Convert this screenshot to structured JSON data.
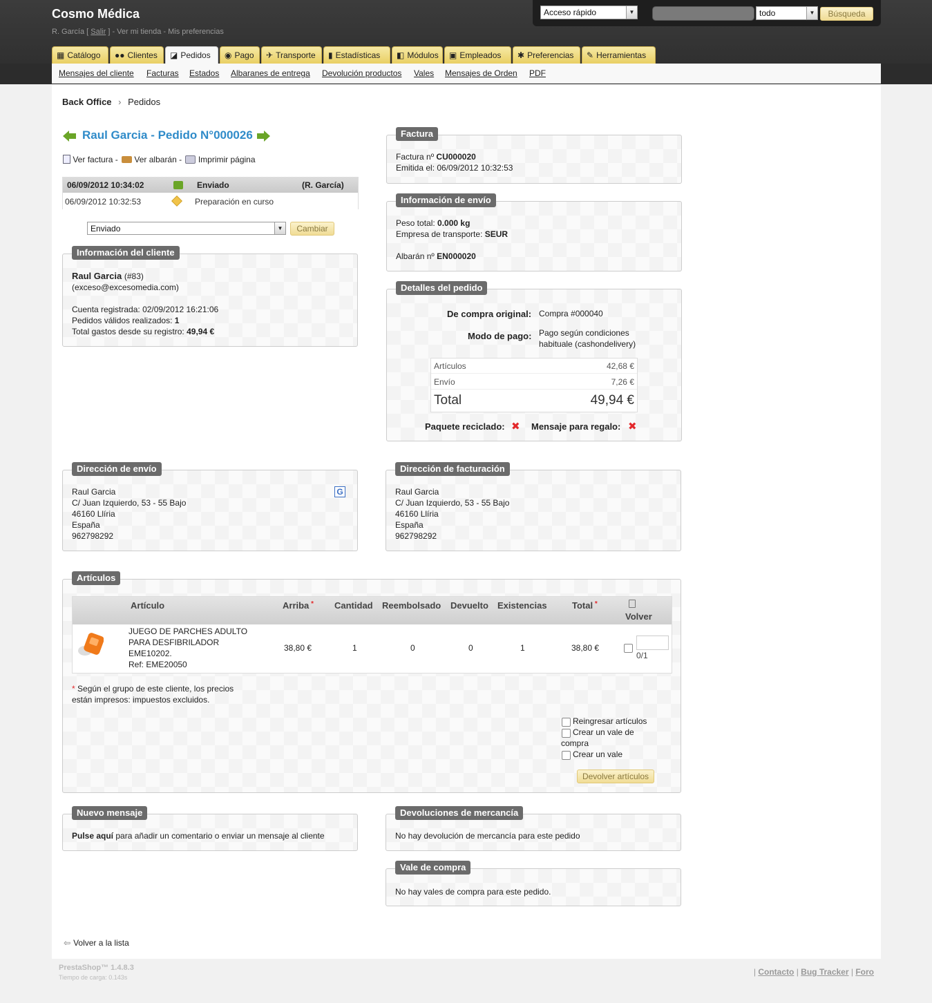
{
  "header": {
    "shop_name": "Cosmo Médica",
    "user_name": "R. García [",
    "logout": "Salir",
    "user_rest": "] - Ver mi tienda - Mis preferencias",
    "quick_access": "Acceso rápido",
    "search_scope": "todo",
    "search_button": "Búsqueda"
  },
  "tabs": [
    {
      "label": "Catálogo",
      "icon": "catalog-icon"
    },
    {
      "label": "Clientes",
      "icon": "customers-icon"
    },
    {
      "label": "Pedidos",
      "icon": "orders-icon"
    },
    {
      "label": "Pago",
      "icon": "payment-icon"
    },
    {
      "label": "Transporte",
      "icon": "shipping-icon"
    },
    {
      "label": "Estadísticas",
      "icon": "stats-icon"
    },
    {
      "label": "Módulos",
      "icon": "modules-icon"
    },
    {
      "label": "Empleados",
      "icon": "employees-icon"
    },
    {
      "label": "Preferencias",
      "icon": "preferences-icon"
    },
    {
      "label": "Herramientas",
      "icon": "tools-icon"
    }
  ],
  "subnav": [
    "Mensajes del cliente",
    "Facturas",
    "Estados",
    "Albaranes de entrega",
    "Devolución productos",
    "Vales",
    "Mensajes de Orden",
    "PDF"
  ],
  "breadcrumb": {
    "root": "Back Office",
    "current": "Pedidos"
  },
  "order": {
    "title": "Raul Garcia - Pedido N°000026",
    "view_invoice": "Ver factura -",
    "view_delivery": "Ver albarán -",
    "print_page": "Imprimir página",
    "history": [
      {
        "date": "06/09/2012 10:34:02",
        "state": "Enviado",
        "employee": "(R. García)"
      },
      {
        "date": "06/09/2012 10:32:53",
        "state": "Preparación en curso",
        "employee": ""
      }
    ],
    "state_select": "Enviado",
    "change_button": "Cambiar"
  },
  "customer": {
    "legend": "Información del cliente",
    "name": "Raul Garcia",
    "id": "(#83)",
    "email": "(exceso@excesomedia.com)",
    "registered_label": "Cuenta registrada:",
    "registered": "02/09/2012 16:21:06",
    "valid_orders_label": "Pedidos válidos realizados:",
    "valid_orders": "1",
    "total_spent_label": "Total gastos desde su registro:",
    "total_spent": "49,94 €"
  },
  "invoice": {
    "legend": "Factura",
    "number_label": "Factura nº",
    "number": "CU000020",
    "issued_label": "Emitida el:",
    "issued": "06/09/2012 10:32:53"
  },
  "shipping_info": {
    "legend": "Información de envío",
    "weight_label": "Peso total:",
    "weight": "0.000 kg",
    "carrier_label": "Empresa de transporte:",
    "carrier": "SEUR",
    "delivery_label": "Albarán nº",
    "delivery": "EN000020"
  },
  "order_details": {
    "legend": "Detalles del pedido",
    "original_label": "De compra original:",
    "original": "Compra #000040",
    "payment_label": "Modo de pago:",
    "payment_line1": "Pago según condiciones",
    "payment_line2": "habituale (cashondelivery)",
    "articles_label": "Artículos",
    "articles": "42,68 €",
    "shipping_label": "Envío",
    "shipping": "7,26 €",
    "total_label": "Total",
    "total": "49,94 €",
    "recycled_label": "Paquete reciclado:",
    "gift_label": "Mensaje para regalo:"
  },
  "shipping_address": {
    "legend": "Dirección de envío",
    "lines": [
      "Raul Garcia",
      "C/ Juan Izquierdo, 53 - 55 Bajo",
      "46160 Llíria",
      "España",
      "962798292"
    ]
  },
  "billing_address": {
    "legend": "Dirección de facturación",
    "lines": [
      "Raul Garcia",
      "C/ Juan Izquierdo, 53 - 55 Bajo",
      "46160 Llíria",
      "España",
      "962798292"
    ]
  },
  "products": {
    "legend": "Artículos",
    "columns": [
      "Artículo",
      "Arriba",
      "Cantidad",
      "Reembolsado",
      "Devuelto",
      "Existencias",
      "Total",
      "Volver"
    ],
    "rows": [
      {
        "name_lines": [
          "JUEGO DE PARCHES ADULTO",
          "PARA DESFIBRILADOR",
          "EME10202.",
          "Ref: EME20050"
        ],
        "price": "38,80 €",
        "quantity": "1",
        "refunded": "0",
        "returned": "0",
        "stock": "1",
        "total": "38,80 €",
        "return_qty": "0/1"
      }
    ],
    "note_line1": "Según el grupo de este cliente, los precios",
    "note_line2": "están impresos: impuestos excluidos.",
    "reinject": "Reingresar artículos",
    "voucher_line1": "Crear un vale de",
    "voucher_line2": "compra",
    "voucher": "Crear un vale",
    "return_button": "Devolver artículos"
  },
  "new_message": {
    "legend": "Nuevo mensaje",
    "bold": "Pulse aquí",
    "text": "para añadir un comentario o enviar un mensaje al cliente"
  },
  "returns": {
    "legend": "Devoluciones de mercancía",
    "text": "No hay devolución de mercancía para este pedido"
  },
  "vouchers": {
    "legend": "Vale de compra",
    "text": "No hay vales de compra para este pedido."
  },
  "back_link": "Volver a la lista",
  "footer": {
    "version": "PrestaShop™ 1.4.8.3",
    "load_time": "Tiempo de carga: 0.143s",
    "contact": "Contacto",
    "bug_tracker": "Bug Tracker",
    "forum": "Foro"
  },
  "colors": {
    "accent_title": "#2f8bc9",
    "tab_yellow": "#eed77a",
    "legend_gray": "#6b6b6b",
    "red_x": "#e3292c",
    "arrow_green": "#6aa527"
  }
}
